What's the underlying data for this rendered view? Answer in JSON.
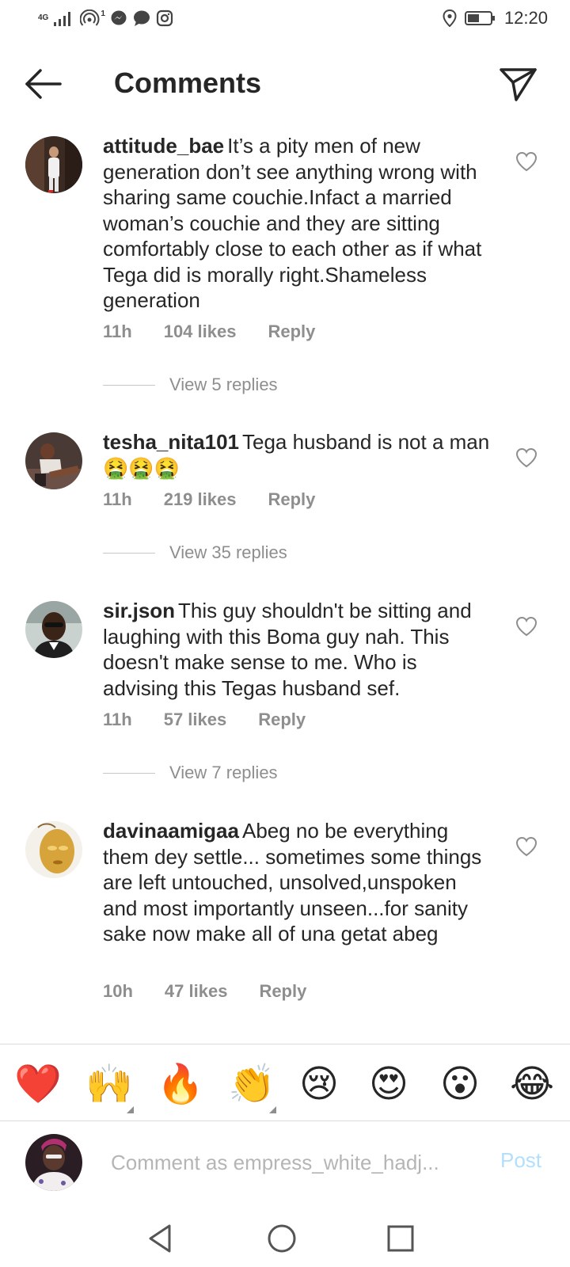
{
  "status_bar": {
    "network": "4G",
    "signal_sub": "1",
    "time": "12:20"
  },
  "header": {
    "title": "Comments",
    "back_icon": "arrow-left-icon",
    "send_icon": "paper-plane-icon"
  },
  "comments": [
    {
      "username": "attitude_bae",
      "text": "It’s a pity men of new generation don’t see anything wrong with sharing same couchie.Infact a married woman’s couchie and they are sitting  comfortably close to each other as if what Tega did is morally right.Shameless generation",
      "time": "11h",
      "likes": "104 likes",
      "reply": "Reply",
      "view_replies": "View 5 replies"
    },
    {
      "username": "tesha_nita101",
      "text": "Tega husband is not a man 🤮🤮🤮",
      "time": "11h",
      "likes": "219 likes",
      "reply": "Reply",
      "view_replies": "View 35 replies"
    },
    {
      "username": "sir.json",
      "text": "This guy shouldn't be sitting and laughing with this Boma guy nah. This doesn't make sense to me. Who is advising this Tegas husband sef.",
      "time": "11h",
      "likes": "57 likes",
      "reply": "Reply",
      "view_replies": "View 7 replies"
    },
    {
      "username": "davinaamigaa",
      "text": "Abeg no be everything them dey settle... sometimes some things are left untouched, unsolved,unspoken and most importantly unseen...for sanity sake now make all of una getat abeg",
      "time": "10h",
      "likes": "47 likes",
      "reply": "Reply"
    }
  ],
  "emoji_bar": [
    "❤️",
    "🙌",
    "🔥",
    "👏",
    "😢",
    "😍",
    "😮",
    "😂"
  ],
  "composer": {
    "placeholder": "Comment as empress_white_hadj...",
    "post_label": "Post"
  },
  "colors": {
    "text": "#262626",
    "meta": "#8e8e8e",
    "post_disabled": "#b2dffc",
    "divider": "#dbdbdb"
  }
}
